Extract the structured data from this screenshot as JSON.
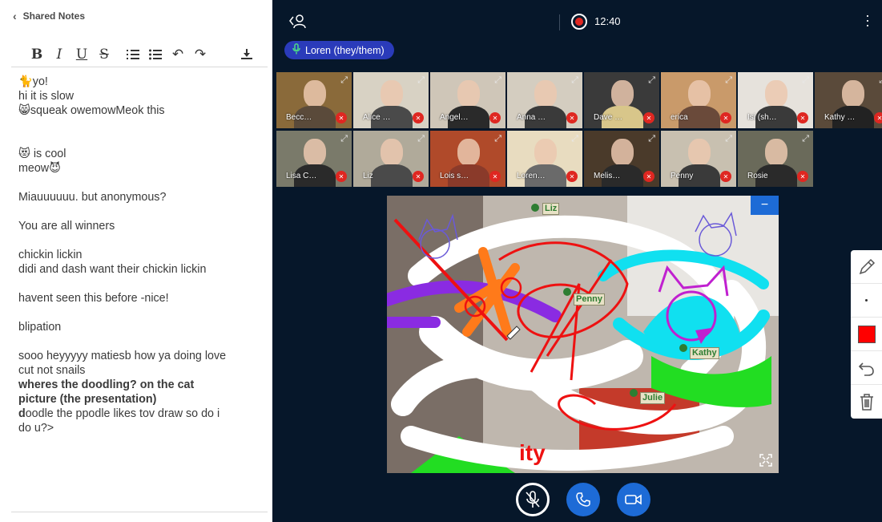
{
  "notes": {
    "header_label": "Shared Notes",
    "back_icon": "chevron-left-icon",
    "toolbar": [
      {
        "name": "bold-button",
        "glyph": "B"
      },
      {
        "name": "italic-button",
        "glyph": "I"
      },
      {
        "name": "underline-button",
        "glyph": "U"
      },
      {
        "name": "strikethrough-button",
        "glyph": "S"
      },
      {
        "name": "ordered-list-button",
        "glyph": "≡"
      },
      {
        "name": "bullet-list-button",
        "glyph": "☰"
      },
      {
        "name": "undo-button",
        "glyph": "↶"
      },
      {
        "name": "redo-button",
        "glyph": "↷"
      },
      {
        "name": "download-button",
        "glyph": "⤓"
      }
    ],
    "lines": [
      {
        "text": "🐈yo!",
        "bold": false
      },
      {
        "text": "hi it is slow",
        "bold": false
      },
      {
        "text": "😸squeak owemowMeok this",
        "bold": false
      },
      {
        "text": "",
        "bold": false
      },
      {
        "text": "",
        "bold": false
      },
      {
        "text": "😻 is cool",
        "bold": false
      },
      {
        "text": "meow😈",
        "bold": false
      },
      {
        "text": "",
        "bold": false
      },
      {
        "text": "Miauuuuuu. but anonymous?",
        "bold": false
      },
      {
        "text": "",
        "bold": false
      },
      {
        "text": "You are all winners",
        "bold": false
      },
      {
        "text": "",
        "bold": false
      },
      {
        "text": "chickin lickin",
        "bold": false
      },
      {
        "text": "didi and dash want their chickin lickin",
        "bold": false
      },
      {
        "text": "",
        "bold": false
      },
      {
        "text": "havent seen this before -nice!",
        "bold": false
      },
      {
        "text": "",
        "bold": false
      },
      {
        "text": "blipation",
        "bold": false
      },
      {
        "text": "",
        "bold": false
      },
      {
        "text": "sooo heyyyyy matiesb how ya doing love",
        "bold": false
      },
      {
        "text": "cut not snails",
        "bold": false
      },
      {
        "text": "wheres the doodling? on the cat",
        "bold": true
      },
      {
        "text": "picture (the presentation)",
        "bold": true
      },
      {
        "text": "doodle the ppodle likes tov draw so do i",
        "bold": false,
        "first_bold": "d"
      },
      {
        "text": "do u?>",
        "bold": false
      }
    ]
  },
  "meeting": {
    "recording_time": "12:40",
    "current_speaker": "Loren (they/them)",
    "speaker_icon": "microphone-icon",
    "user_list_icon": "user-list-icon",
    "more_options_icon": "kebab-menu-icon",
    "participants": [
      {
        "name": "Becc…",
        "color": "#8a6a3a",
        "shirt": "#5a4a3a"
      },
      {
        "name": "Alice …",
        "color": "#d8d2c4",
        "shirt": "#4a4a4a"
      },
      {
        "name": "Angel…",
        "color": "#cfc6b8",
        "shirt": "#2a2a2a"
      },
      {
        "name": "Anna …",
        "color": "#d4cdc0",
        "shirt": "#3a3a3a"
      },
      {
        "name": "Dave …",
        "color": "#3a3a3a",
        "shirt": "#d8c68a"
      },
      {
        "name": "erica",
        "color": "#c99a6a",
        "shirt": "#6a4a3a"
      },
      {
        "name": "Isi (sh…",
        "color": "#e6e2dc",
        "shirt": "#3a3a3a"
      },
      {
        "name": "Kathy …",
        "color": "#5a4a3a",
        "shirt": "#222222"
      },
      {
        "name": "Lisa C…",
        "color": "#7a7a6a",
        "shirt": "#2a2a2a"
      },
      {
        "name": "Liz",
        "color": "#b0aa9a",
        "shirt": "#4a4a4a"
      },
      {
        "name": "Lois s…",
        "color": "#b04a2a",
        "shirt": "#8a3a2a"
      },
      {
        "name": "Loren…",
        "color": "#e8dcc0",
        "shirt": "#6a6a6a"
      },
      {
        "name": "Melis…",
        "color": "#4a3a2a",
        "shirt": "#2a2a2a"
      },
      {
        "name": "Penny",
        "color": "#c8c0b0",
        "shirt": "#3a3a3a"
      },
      {
        "name": "Rosie",
        "color": "#6a6a5a",
        "shirt": "#2a2a2a"
      }
    ],
    "presentation": {
      "cursor_labels": [
        "Liz",
        "Penny",
        "Kathy",
        "Julie"
      ],
      "minimize_label": "−"
    },
    "annotation_tools": [
      "pen-tool",
      "thickness-tool",
      "color-tool",
      "undo-annotation",
      "clear-annotations"
    ],
    "annotation_color": "#ff0000",
    "controls": [
      "unmute-mic-button",
      "leave-audio-button",
      "share-webcam-button"
    ]
  }
}
